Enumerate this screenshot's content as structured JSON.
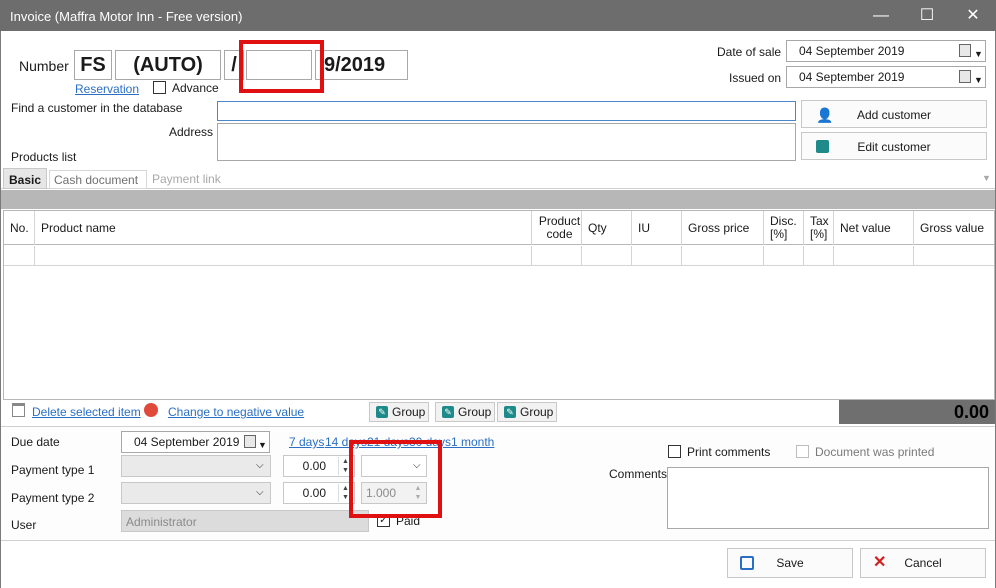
{
  "window": {
    "title": "Invoice   (Maffra Motor Inn - Free version)",
    "minimize": "—",
    "maximize": "☐",
    "close": "✕"
  },
  "number": {
    "label": "Number",
    "prefix": "FS",
    "auto": "(AUTO)",
    "slash": "/",
    "middle": "",
    "year": "9/2019"
  },
  "reservation_link": "Reservation",
  "advance_label": "Advance",
  "date_of_sale": {
    "label": "Date of sale",
    "value": "04  September  2019"
  },
  "issued_on": {
    "label": "Issued on",
    "value": "04  September  2019"
  },
  "customer": {
    "find_label": "Find a customer in the database",
    "address_label": "Address",
    "find_value": "",
    "address_value": ""
  },
  "buttons": {
    "add_customer": "Add customer",
    "edit_customer": "Edit customer",
    "save": "Save",
    "cancel": "Cancel"
  },
  "products_list_label": "Products list",
  "tabs": [
    {
      "label": "Basic"
    },
    {
      "label": "Cash document"
    },
    {
      "label": "Payment link"
    }
  ],
  "table": {
    "headers": [
      "No.",
      "Product name",
      "Product code",
      "Qty",
      "IU",
      "Gross price",
      "Disc. [%]",
      "Tax [%]",
      "Net value",
      "Gross value"
    ]
  },
  "actions": {
    "delete_selected": "Delete selected item",
    "change_negative": "Change to negative value",
    "group1": "Group",
    "group2": "Group",
    "group3": "Group"
  },
  "total": "0.00",
  "due_date": {
    "label": "Due date",
    "value": "04  September  2019",
    "quick_links": [
      "7 days",
      "14 days",
      "21 days",
      "30 days",
      "1 month"
    ]
  },
  "payment_type_1": {
    "label": "Payment type 1",
    "amount": "0.00",
    "currency": ""
  },
  "payment_type_2": {
    "label": "Payment type 2",
    "amount": "0.00",
    "rate": "1.000"
  },
  "user": {
    "label": "User",
    "value": "Administrator"
  },
  "paid_label": "Paid",
  "print_comments_label": "Print comments",
  "document_printed_label": "Document was printed",
  "comments_label": "Comments"
}
